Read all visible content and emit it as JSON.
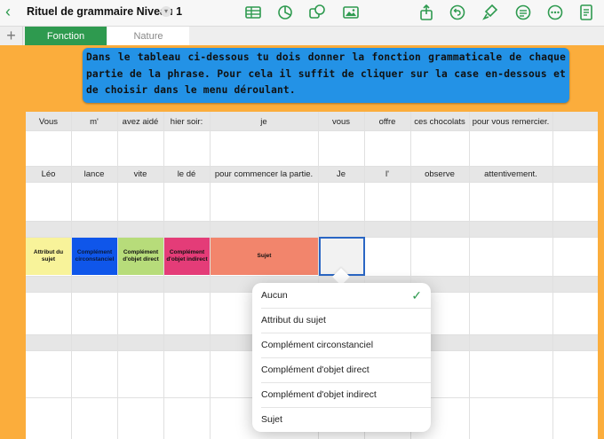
{
  "toolbar": {
    "back_icon": "chevron-left-icon",
    "title": "Rituel de grammaire Niveau 1",
    "title_menu_icon": "chevron-down-icon",
    "center_icons": [
      "table-icon",
      "chart-icon",
      "shapes-icon",
      "media-icon"
    ],
    "right_icons": [
      "share-icon",
      "undo-icon",
      "format-brush-icon",
      "list-icon",
      "more-icon",
      "document-icon"
    ],
    "accent": "#2e9a4f"
  },
  "tabs": {
    "add_label": "+",
    "items": [
      {
        "label": "Fonction",
        "active": true
      },
      {
        "label": "Nature",
        "active": false
      }
    ]
  },
  "instruction": {
    "text": "Dans le tableau ci-dessous tu dois donner la fonction grammaticale de chaque partie de la phrase. Pour cela il suffit de cliquer sur la case en-dessous et de choisir dans le menu déroulant.",
    "color": "#2392e6"
  },
  "table": {
    "row1": [
      "Vous",
      "m'",
      "avez aidé",
      "hier soir:",
      "je",
      "vous",
      "offre",
      "ces chocolats",
      "pour vous remercier."
    ],
    "row2": [
      "Léo",
      "lance",
      "vite",
      "le dé",
      "pour commencer la partie.",
      "Je",
      "l'",
      "observe",
      "attentivement."
    ],
    "legend": [
      {
        "label": "Attribut du sujet",
        "color": "#f8f39a"
      },
      {
        "label": "Complément circonstanciel",
        "color": "#0f56ea"
      },
      {
        "label": "Complément d'objet direct",
        "color": "#b7dc7a"
      },
      {
        "label": "Complément d'objet indirect",
        "color": "#e43c78"
      },
      {
        "label": "Sujet",
        "color": "#f2856c"
      }
    ]
  },
  "dropdown": {
    "options": [
      "Aucun",
      "Attribut du sujet",
      "Complément circonstanciel",
      "Complément d'objet direct",
      "Complément d'objet indirect",
      "Sujet"
    ],
    "selected_index": 0,
    "check_icon": "checkmark-icon"
  }
}
